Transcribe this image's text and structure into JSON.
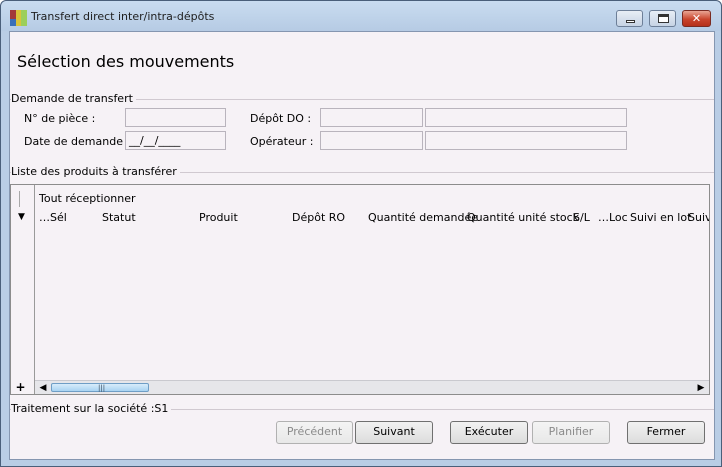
{
  "window": {
    "title": "Transfert direct inter/intra-dépôts"
  },
  "page_title": "Sélection des mouvements",
  "demande": {
    "group_label": "Demande de transfert",
    "numero_piece_label": "N° de pièce :",
    "numero_piece_value": "",
    "date_label": "Date de demande :",
    "date_value": "__/__/____",
    "depot_label": "Dépôt DO :",
    "depot_code": "",
    "depot_name": "",
    "operateur_label": "Opérateur :",
    "operateur_code": "",
    "operateur_name": ""
  },
  "liste": {
    "group_label": "Liste des produits à transférer",
    "group_cell": "Tout réceptionner",
    "columns": [
      "…Sél",
      "Statut",
      "Produit",
      "Dépôt RO",
      "Quantité demandée",
      "Quantité unité stock",
      "S/L",
      "…Loc",
      "Suivi en lot",
      "Suivi"
    ],
    "rows": [],
    "add_label": "+"
  },
  "status": {
    "text": "Traitement sur la société :S1"
  },
  "buttons": {
    "precedent": "Précédent",
    "suivant": "Suivant",
    "executer": "Exécuter",
    "planifier": "Planifier",
    "fermer": "Fermer"
  }
}
